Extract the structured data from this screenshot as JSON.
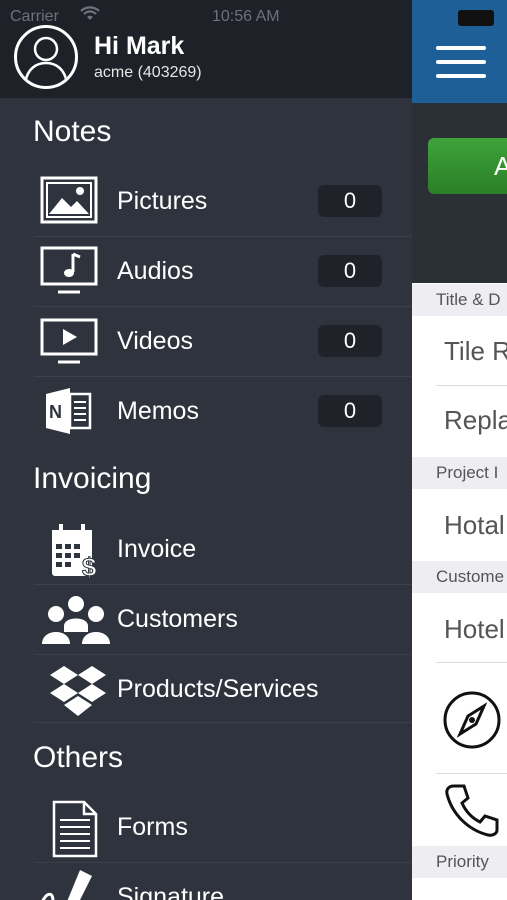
{
  "status": {
    "carrier": "Carrier",
    "time": "10:56 AM"
  },
  "profile": {
    "greeting": "Hi Mark",
    "account": "acme (403269)"
  },
  "sections": {
    "notes": "Notes",
    "invoicing": "Invoicing",
    "others": "Others"
  },
  "notes_items": [
    {
      "label": "Pictures",
      "count": "0"
    },
    {
      "label": "Audios",
      "count": "0"
    },
    {
      "label": "Videos",
      "count": "0"
    },
    {
      "label": "Memos",
      "count": "0"
    }
  ],
  "invoicing_items": [
    {
      "label": "Invoice"
    },
    {
      "label": "Customers"
    },
    {
      "label": "Products/Services"
    }
  ],
  "others_items": [
    {
      "label": "Forms"
    },
    {
      "label": "Signature"
    }
  ],
  "pane": {
    "button_label": "A",
    "sections": {
      "title": "Title & D",
      "project": "Project I",
      "customer": "Custome",
      "priority": "Priority"
    },
    "values": {
      "title_value": "Tile R",
      "description_value": "Repla",
      "project_value": "Hotal",
      "customer_value": "Hotel"
    }
  },
  "colors": {
    "menu_bg": "#2f333d",
    "header_bg": "#1e2127",
    "nav_blue": "#1f5f97",
    "button_green": "#3a9a35"
  }
}
